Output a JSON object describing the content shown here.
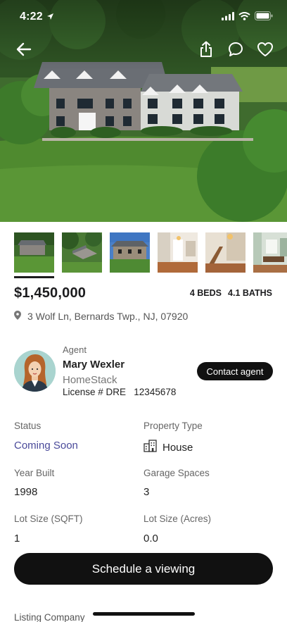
{
  "status_bar": {
    "time": "4:22"
  },
  "listing": {
    "price": "$1,450,000",
    "beds": "4 BEDS",
    "baths": "4.1 BATHS",
    "address": "3 Wolf Ln, Bernards Twp., NJ, 07920"
  },
  "agent": {
    "caption": "Agent",
    "name": "Mary Wexler",
    "company": "HomeStack",
    "license": "License # DRE   12345678",
    "contact_label": "Contact agent"
  },
  "details": {
    "status": {
      "label": "Status",
      "value": "Coming Soon"
    },
    "property_type": {
      "label": "Property Type",
      "value": "House"
    },
    "year_built": {
      "label": "Year Built",
      "value": "1998"
    },
    "garage_spaces": {
      "label": "Garage Spaces",
      "value": "3"
    },
    "lot_size_sqft": {
      "label": "Lot Size (SQFT)",
      "value": "1"
    },
    "lot_size_acres": {
      "label": "Lot Size (Acres)",
      "value": "0.0"
    }
  },
  "cta": {
    "label": "Schedule a viewing"
  },
  "listing_company": {
    "label": "Listing Company"
  },
  "colors": {
    "accent": "#111111",
    "status": "#4a4a9a"
  }
}
